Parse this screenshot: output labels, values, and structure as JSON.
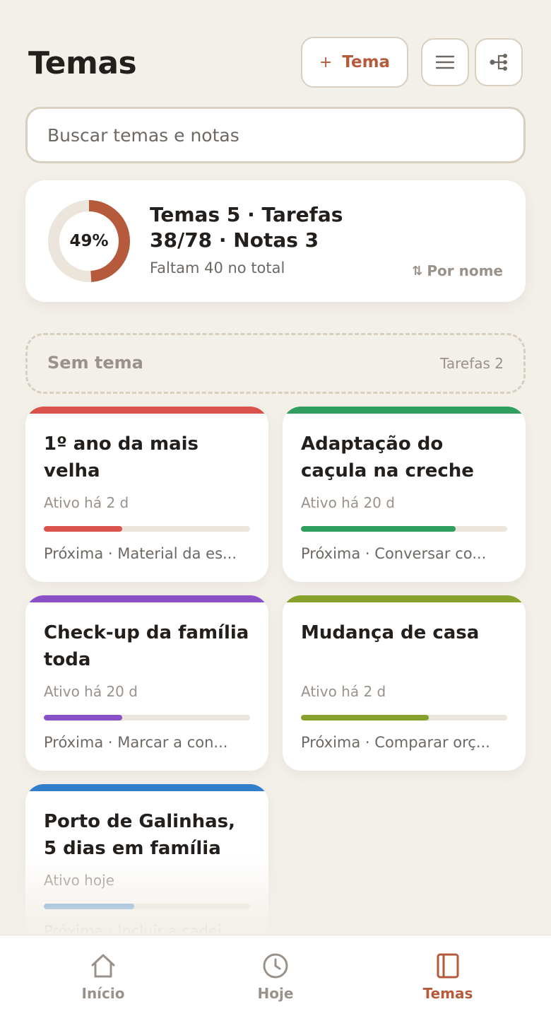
{
  "colors": {
    "accent": "#b65a3c",
    "background": "#f3efe9",
    "muted": "#9a928a",
    "border": "#d8cfc0"
  },
  "header": {
    "title": "Temas",
    "add_plus": "+",
    "add_label": "Tema",
    "list_icon": "list-icon",
    "tree_icon": "tree-icon"
  },
  "search": {
    "placeholder": "Buscar temas e notas"
  },
  "summary": {
    "percent_label": "49%",
    "percent_value": 49,
    "line1": "Temas 5 · Tarefas",
    "line2": "38/78 · Notas 3",
    "subtitle": "Faltam 40 no total",
    "sort_label": "Por nome"
  },
  "no_theme": {
    "label": "Sem tema",
    "count": "Tarefas 2"
  },
  "themes": [
    {
      "title": "1º ano da mais velha",
      "active": "Ativo há 2 d",
      "next": "Próxima · Material da es...",
      "color": "#d9524c",
      "progress": 0.38
    },
    {
      "title": "Adaptação do caçula na creche",
      "active": "Ativo há 20 d",
      "next": "Próxima · Conversar co...",
      "color": "#2f9e5e",
      "progress": 0.75
    },
    {
      "title": "Check-up da família toda",
      "active": "Ativo há 20 d",
      "next": "Próxima · Marcar a con...",
      "color": "#8a50c8",
      "progress": 0.38
    },
    {
      "title": "Mudança de casa",
      "active": "Ativo há 2 d",
      "next": "Próxima · Comparar orç...",
      "color": "#86a22c",
      "progress": 0.62
    },
    {
      "title": "Porto de Galinhas, 5 dias em família",
      "active": "Ativo hoje",
      "next": "Próxima · Incluir a cadei...",
      "color": "#2f7fcb",
      "progress": 0.44
    }
  ],
  "nav": [
    {
      "label": "Início",
      "icon": "home-icon",
      "active": false
    },
    {
      "label": "Hoje",
      "icon": "clock-icon",
      "active": false
    },
    {
      "label": "Temas",
      "icon": "book-icon",
      "active": true
    }
  ]
}
